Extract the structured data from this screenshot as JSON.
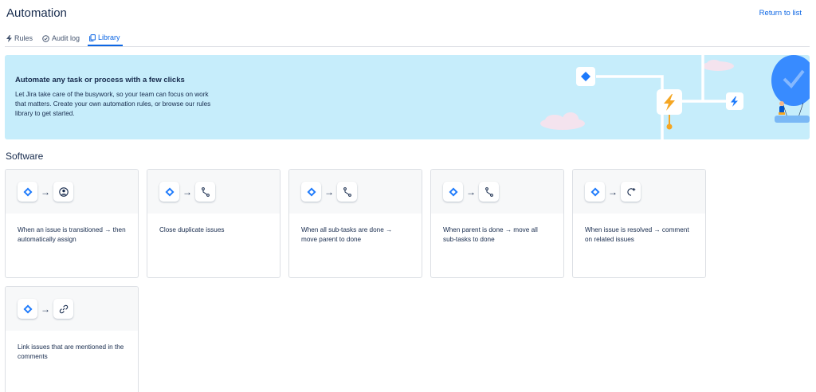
{
  "header": {
    "title": "Automation",
    "return_link": "Return to list"
  },
  "tabs": [
    {
      "label": "Rules",
      "icon": "lightning-icon"
    },
    {
      "label": "Audit log",
      "icon": "check-circle-icon"
    },
    {
      "label": "Library",
      "icon": "copy-icon",
      "active": true
    }
  ],
  "banner": {
    "heading": "Automate any task or process with a few clicks",
    "text": "Let Jira take care of the busywork, so your team can focus on work that matters. Create your own automation rules, or browse our rules library to get started."
  },
  "section": {
    "title": "Software"
  },
  "templates": [
    {
      "trigger_icon": "trigger-diamond-icon",
      "action_icon": "user-circle-icon",
      "text": "When an issue is transitioned → then automatically assign"
    },
    {
      "trigger_icon": "trigger-diamond-icon",
      "action_icon": "transition-icon",
      "text": "Close duplicate issues"
    },
    {
      "trigger_icon": "trigger-diamond-icon",
      "action_icon": "transition-icon",
      "text": "When all sub-tasks are done → move parent to done"
    },
    {
      "trigger_icon": "trigger-diamond-icon",
      "action_icon": "transition-icon",
      "text": "When parent is done → move all sub-tasks to done"
    },
    {
      "trigger_icon": "trigger-diamond-icon",
      "action_icon": "comment-add-icon",
      "text": "When issue is resolved → comment on related issues"
    },
    {
      "trigger_icon": "trigger-diamond-icon",
      "action_icon": "link-icon",
      "text": "Link issues that are mentioned in the comments"
    }
  ],
  "colors": {
    "accent": "#0c66e4",
    "banner_bg": "#c6edfb",
    "trigger_blue": "#1d7afc",
    "bolt_orange": "#f5a623"
  }
}
